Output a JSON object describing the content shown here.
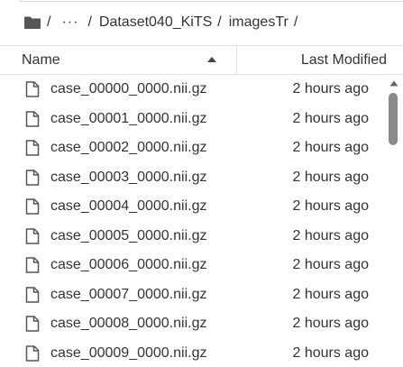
{
  "breadcrumb": {
    "root_icon": "folder-icon",
    "ellipsis": "···",
    "path": [
      "Dataset040_KiTS",
      "imagesTr"
    ],
    "separator": "/"
  },
  "columns": {
    "name": "Name",
    "modified": "Last Modified",
    "sort_icon": "caret-up-icon"
  },
  "files": [
    {
      "name": "case_00000_0000.nii.gz",
      "modified": "2 hours ago"
    },
    {
      "name": "case_00001_0000.nii.gz",
      "modified": "2 hours ago"
    },
    {
      "name": "case_00002_0000.nii.gz",
      "modified": "2 hours ago"
    },
    {
      "name": "case_00003_0000.nii.gz",
      "modified": "2 hours ago"
    },
    {
      "name": "case_00004_0000.nii.gz",
      "modified": "2 hours ago"
    },
    {
      "name": "case_00005_0000.nii.gz",
      "modified": "2 hours ago"
    },
    {
      "name": "case_00006_0000.nii.gz",
      "modified": "2 hours ago"
    },
    {
      "name": "case_00007_0000.nii.gz",
      "modified": "2 hours ago"
    },
    {
      "name": "case_00008_0000.nii.gz",
      "modified": "2 hours ago"
    },
    {
      "name": "case_00009_0000.nii.gz",
      "modified": "2 hours ago"
    }
  ],
  "colors": {
    "text": "#333333",
    "border": "#e0e0e0",
    "scroll_thumb": "#8a8a8a"
  }
}
